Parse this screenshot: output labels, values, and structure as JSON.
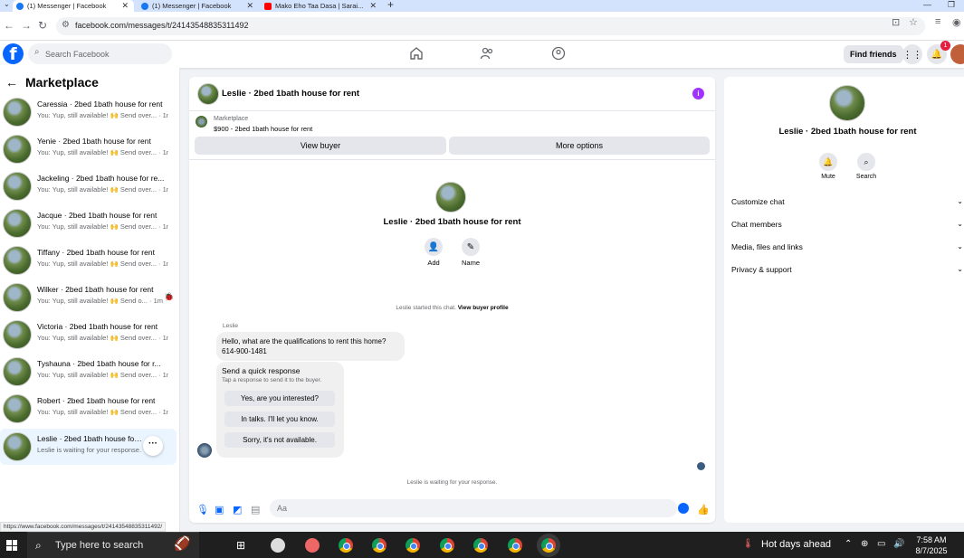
{
  "browser": {
    "tabs": [
      {
        "title": "(1) Messenger | Facebook",
        "active": true
      },
      {
        "title": "(1) Messenger | Facebook",
        "active": false
      },
      {
        "title": "Mako Eho Taa Dasa | Sarai...",
        "active": false
      }
    ],
    "url": "facebook.com/messages/t/24143548835311492",
    "status_url": "https://www.facebook.com/messages/t/24143548835311492/"
  },
  "fbnav": {
    "search_placeholder": "Search Facebook",
    "find_friends": "Find friends",
    "notification_count": "1"
  },
  "sidebar": {
    "title": "Marketplace",
    "chats": [
      {
        "name": "Caressia · 2bed 1bath house for rent",
        "snippet": "You: Yup, still available! 🙌 Send over... · 1m"
      },
      {
        "name": "Yenie · 2bed 1bath house for rent",
        "snippet": "You: Yup, still available! 🙌 Send over... · 1m"
      },
      {
        "name": "Jackeling · 2bed 1bath house for re...",
        "snippet": "You: Yup, still available! 🙌 Send over... · 1m"
      },
      {
        "name": "Jacque · 2bed 1bath house for rent",
        "snippet": "You: Yup, still available! 🙌 Send over... · 1m"
      },
      {
        "name": "Tiffany · 2bed 1bath house for rent",
        "snippet": "You: Yup, still available! 🙌 Send over... · 1m"
      },
      {
        "name": "Wilker · 2bed 1bath house for rent",
        "snippet": "You: Yup, still available! 🙌 Send o... · 1m"
      },
      {
        "name": "Victoria · 2bed 1bath house for rent",
        "snippet": "You: Yup, still available! 🙌 Send over... · 1m"
      },
      {
        "name": "Tyshauna · 2bed 1bath house for r...",
        "snippet": "You: Yup, still available! 🙌 Send over... · 1m"
      },
      {
        "name": "Robert · 2bed 1bath house for rent",
        "snippet": "You: Yup, still available! 🙌 Send over... · 1m"
      },
      {
        "name": "Leslie · 2bed 1bath house for re...",
        "snippet": "Leslie is waiting for your response. · 1m"
      }
    ]
  },
  "chat": {
    "title": "Leslie · 2bed 1bath house for rent",
    "marketplace_label": "Marketplace",
    "listing": "$900 - 2bed 1bath house for rent",
    "view_buyer": "View buyer",
    "more_options": "More options",
    "profile_name": "Leslie · 2bed 1bath house for rent",
    "add_label": "Add",
    "name_label": "Name",
    "started_text": "Leslie started this chat.",
    "view_buyer_profile": "View buyer profile",
    "sender": "Leslie",
    "message_line1": "Hello, what are the qualifications to rent this home?",
    "message_line2": "614-900-1481",
    "quick_title": "Send a quick response",
    "quick_sub": "Tap a response to send it to the buyer.",
    "quick_responses": [
      "Yes, are you interested?",
      "In talks. I'll let you know.",
      "Sorry, it's not available."
    ],
    "waiting_text": "Leslie is waiting for your response.",
    "composer_placeholder": "Aa"
  },
  "right_panel": {
    "name": "Leslie · 2bed 1bath house for rent",
    "mute": "Mute",
    "search": "Search",
    "sections": [
      "Customize chat",
      "Chat members",
      "Media, files and links",
      "Privacy & support"
    ]
  },
  "taskbar": {
    "search_text": "Type here to search",
    "weather": "Hot days ahead",
    "time": "7:58 AM",
    "date": "8/7/2025"
  },
  "colors": {
    "fb_blue": "#0866ff",
    "badge_red": "#e41e3f",
    "info_purple": "#a033ff",
    "active_chat_bg": "#ebf5ff"
  }
}
